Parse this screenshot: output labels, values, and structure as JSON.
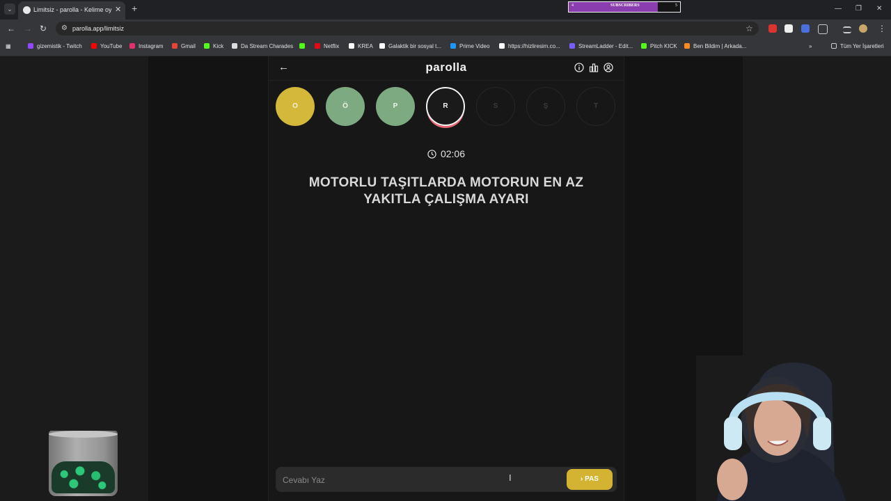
{
  "browser": {
    "tab_menu_icon": "chevron-down-icon",
    "tab_title": "Limitsiz - parolla - Kelime oyunu",
    "url": "parolla.app/limitsiz",
    "subscribers": {
      "current": "4",
      "label": "SUBSCRIBERS",
      "goal": "5",
      "progress": 0.8
    },
    "bookmarks": [
      {
        "label": "gizemistik - Twitch",
        "color": "#9146ff"
      },
      {
        "label": "YouTube",
        "color": "#ff0000"
      },
      {
        "label": "Instagram",
        "color": "#e1306c"
      },
      {
        "label": "Gmail",
        "color": "#ea4335"
      },
      {
        "label": "Kick",
        "color": "#53fc18"
      },
      {
        "label": "Da Stream Charades",
        "color": "#dddddd"
      },
      {
        "label": "",
        "color": "#53fc18"
      },
      {
        "label": "Netflix",
        "color": "#e50914"
      },
      {
        "label": "KREA",
        "color": "#ffffff"
      },
      {
        "label": "Galaktik bir sosyal t...",
        "color": "#ffffff"
      },
      {
        "label": "Prime Video",
        "color": "#1a98ff"
      },
      {
        "label": "https://hizliresim.co...",
        "color": "#ffffff"
      },
      {
        "label": "StreamLadder - Edit...",
        "color": "#7b5cff"
      },
      {
        "label": "Pitch KICK",
        "color": "#53fc18"
      },
      {
        "label": "Ben Bildim | Arkada...",
        "color": "#ff8a1f"
      }
    ],
    "all_bookmarks": "Tüm Yer İşaretleri"
  },
  "app": {
    "logo": "parolla",
    "letters": [
      {
        "letter": "O",
        "state": "correct-yellow"
      },
      {
        "letter": "Ö",
        "state": "correct"
      },
      {
        "letter": "P",
        "state": "correct"
      },
      {
        "letter": "R",
        "state": "active"
      },
      {
        "letter": "S",
        "state": "empty"
      },
      {
        "letter": "Ş",
        "state": "empty"
      },
      {
        "letter": "T",
        "state": "empty"
      }
    ],
    "timer": "02:06",
    "question": "MOTORLU TAŞITLARDA MOTORUN EN AZ YAKITLA ÇALIŞMA AYARI",
    "answer_placeholder": "Cevabı Yaz",
    "pass_label": "PAS",
    "colors": {
      "yellow": "#d4b83a",
      "green": "#7daa80",
      "pass": "#d5b332",
      "active_ring": "#e56772"
    }
  }
}
